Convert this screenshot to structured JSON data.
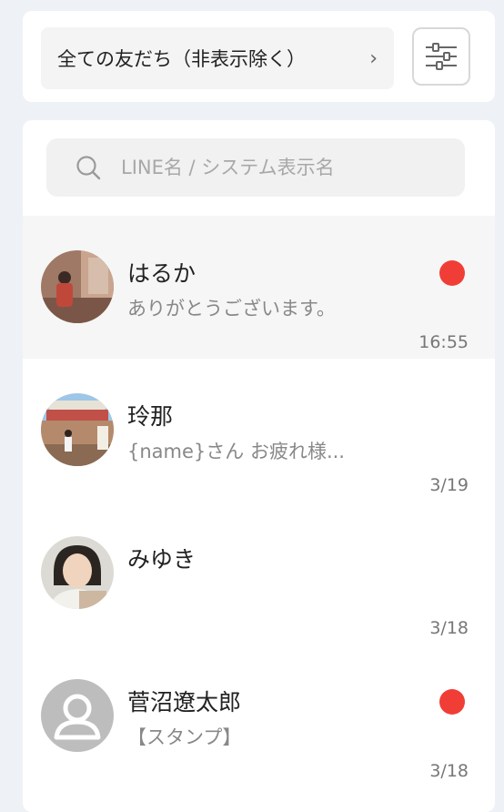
{
  "filter": {
    "label": "全ての友だち（非表示除く）",
    "chevron": "›"
  },
  "search": {
    "placeholder": "LINE名 / システム表示名",
    "value": ""
  },
  "colors": {
    "unread": "#f03e36",
    "active_row": "#f6f6f6",
    "background": "#eef1f6"
  },
  "chats": [
    {
      "name": "はるか",
      "message": "ありがとうございます。",
      "time": "16:55",
      "unread": true,
      "active": true,
      "avatar": "photo-avatar"
    },
    {
      "name": "玲那",
      "message": "{name}さん お疲れ様...",
      "time": "3/19",
      "unread": false,
      "active": false,
      "avatar": "photo-avatar"
    },
    {
      "name": "みゆき",
      "message": "",
      "time": "3/18",
      "unread": false,
      "active": false,
      "avatar": "photo-avatar"
    },
    {
      "name": "菅沼遼太郎",
      "message": "【スタンプ】",
      "time": "3/18",
      "unread": true,
      "active": false,
      "avatar": "default-user-avatar"
    }
  ]
}
